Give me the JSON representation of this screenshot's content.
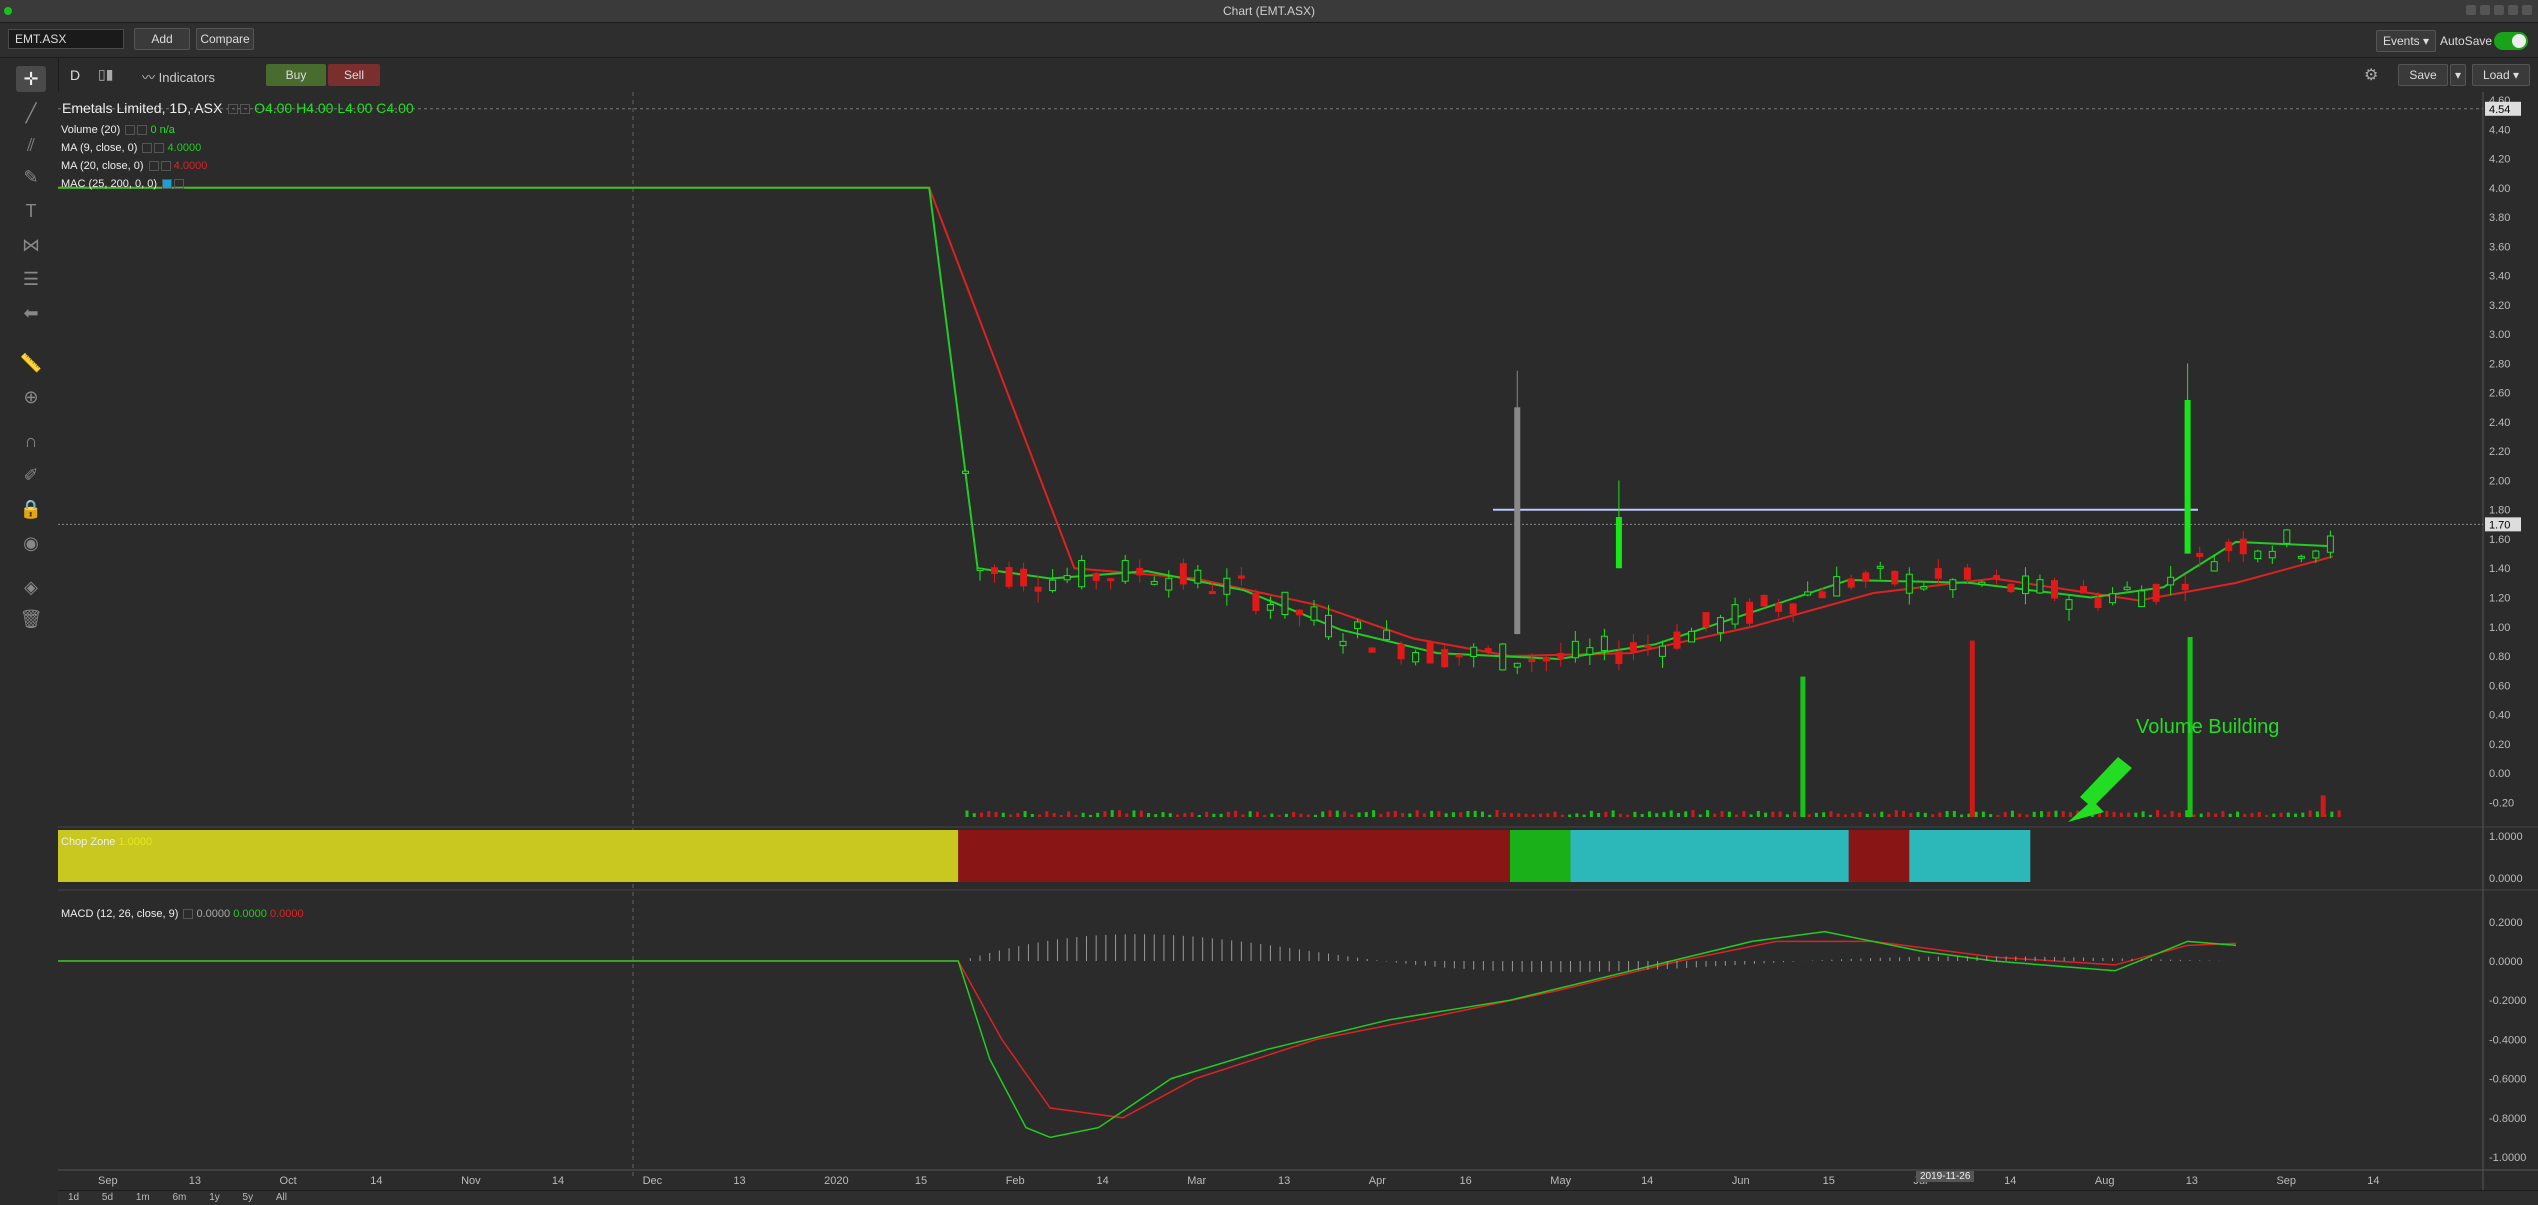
{
  "window": {
    "title": "Chart (EMT.ASX)"
  },
  "toolbar": {
    "symbol": "EMT.ASX",
    "add_label": "Add",
    "compare_label": "Compare",
    "events_label": "Events",
    "autosave_label": "AutoSave",
    "interval_label": "D",
    "indicators_label": "Indicators",
    "buy_label": "Buy",
    "sell_label": "Sell",
    "save_label": "Save",
    "load_label": "Load"
  },
  "legend": {
    "instrument": "Emetals Limited, 1D, ASX",
    "ohlc": "O4.00  H4.00  L4.00  C4.00",
    "volume": "Volume (20)",
    "volume_vals": "0   n/a",
    "ma9": "MA (9, close, 0)",
    "ma9_val": "4.0000",
    "ma20": "MA (20, close, 0)",
    "ma20_val": "4.0000",
    "mac": "MAC (25, 200, 0, 0)",
    "chop": "Chop Zone",
    "chop_val": "1.0000",
    "macd": "MACD (12, 26, close, 9)",
    "macd_vals": [
      "0.0000",
      "0.0000",
      "0.0000"
    ]
  },
  "annotation": {
    "text": "Volume Building"
  },
  "price_axis": {
    "ticks": [
      "4.60",
      "4.40",
      "4.20",
      "4.00",
      "3.80",
      "3.60",
      "3.40",
      "3.20",
      "3.00",
      "2.80",
      "2.60",
      "2.40",
      "2.20",
      "2.00",
      "1.80",
      "1.60",
      "1.40",
      "1.20",
      "1.00",
      "0.80",
      "0.60",
      "0.40",
      "0.20",
      "0.00",
      "-0.20"
    ],
    "last_price_label": "1.70",
    "high_label": "4.54"
  },
  "chop_axis": {
    "ticks": [
      "1.0000",
      "0.0000"
    ]
  },
  "macd_axis": {
    "ticks": [
      "0.2000",
      "0.0000",
      "-0.2000",
      "-0.4000",
      "-0.6000",
      "-0.8000",
      "-1.0000"
    ]
  },
  "time_axis": {
    "labels": [
      "Sep",
      "13",
      "Oct",
      "14",
      "Nov",
      "14",
      "Dec",
      "13",
      "2020",
      "15",
      "Feb",
      "14",
      "Mar",
      "13",
      "Apr",
      "16",
      "May",
      "14",
      "Jun",
      "15",
      "Jul",
      "14",
      "Aug",
      "13",
      "Sep",
      "14"
    ],
    "crosshair_label": "2019-11-26"
  },
  "ranges": [
    "1d",
    "5d",
    "1m",
    "6m",
    "1y",
    "5y",
    "All"
  ],
  "colors": {
    "up": "#19e619",
    "down": "#e01919",
    "ma9": "#22cc22",
    "ma20": "#dd2222",
    "background": "#2b2b2b",
    "annotation": "#22dd22"
  },
  "chart_data": {
    "type": "candlestick",
    "title": "Emetals Limited, 1D, ASX",
    "ylim": [
      -0.3,
      4.6
    ],
    "ma9_path": [
      [
        0,
        4.0
      ],
      [
        0.36,
        4.0
      ],
      [
        0.38,
        1.4
      ],
      [
        0.41,
        1.33
      ],
      [
        0.45,
        1.38
      ],
      [
        0.49,
        1.25
      ],
      [
        0.53,
        0.98
      ],
      [
        0.57,
        0.82
      ],
      [
        0.62,
        0.78
      ],
      [
        0.66,
        0.88
      ],
      [
        0.7,
        1.1
      ],
      [
        0.74,
        1.32
      ],
      [
        0.79,
        1.3
      ],
      [
        0.84,
        1.2
      ],
      [
        0.87,
        1.27
      ],
      [
        0.9,
        1.58
      ],
      [
        0.94,
        1.55
      ]
    ],
    "ma20_path": [
      [
        0,
        4.0
      ],
      [
        0.36,
        4.0
      ],
      [
        0.42,
        1.4
      ],
      [
        0.47,
        1.33
      ],
      [
        0.52,
        1.15
      ],
      [
        0.56,
        0.92
      ],
      [
        0.6,
        0.8
      ],
      [
        0.65,
        0.82
      ],
      [
        0.7,
        1.0
      ],
      [
        0.75,
        1.23
      ],
      [
        0.8,
        1.33
      ],
      [
        0.86,
        1.18
      ],
      [
        0.9,
        1.3
      ],
      [
        0.94,
        1.48
      ]
    ],
    "volume_spikes": [
      [
        0.72,
        0.78
      ],
      [
        0.79,
        0.98
      ],
      [
        0.88,
        1.0
      ],
      [
        0.935,
        0.12
      ]
    ]
  }
}
